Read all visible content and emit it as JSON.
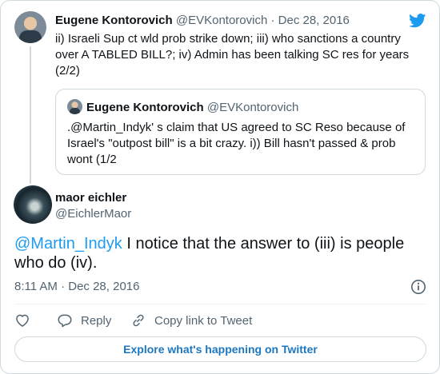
{
  "parent_tweet": {
    "name": "Eugene Kontorovich",
    "handle": "@EVKontorovich",
    "separator": "·",
    "date": "Dec 28, 2016",
    "text": "ii) Israeli Sup ct wld prob strike down; iii) who sanctions a country over A TABLED BILL?; iv) Admin has been talking SC res for years (2/2)"
  },
  "quoted_tweet": {
    "name": "Eugene Kontorovich",
    "handle": "@EVKontorovich",
    "text": ".@Martin_Indyk' s claim that US agreed to SC Reso because of Israel's \"outpost bill\" is a bit crazy. i)) Bill hasn't passed & prob wont (1/2"
  },
  "main_tweet": {
    "name": "maor eichler",
    "handle": "@EichlerMaor",
    "mention": "@Martin_Indyk",
    "text": " I notice that the answer to (iii) is people who do (iv).",
    "timestamp": "8:11 AM · Dec 28, 2016"
  },
  "actions": {
    "reply": "Reply",
    "copy_link": "Copy link to Tweet"
  },
  "explore_label": "Explore what's happening on Twitter",
  "icons": {
    "brand": "twitter-bird-icon",
    "like": "heart-icon",
    "reply": "comment-bubble-icon",
    "copy": "link-icon",
    "info": "info-icon"
  },
  "colors": {
    "accent": "#1d9bf0",
    "muted": "#536471",
    "border": "#cfd9de"
  }
}
